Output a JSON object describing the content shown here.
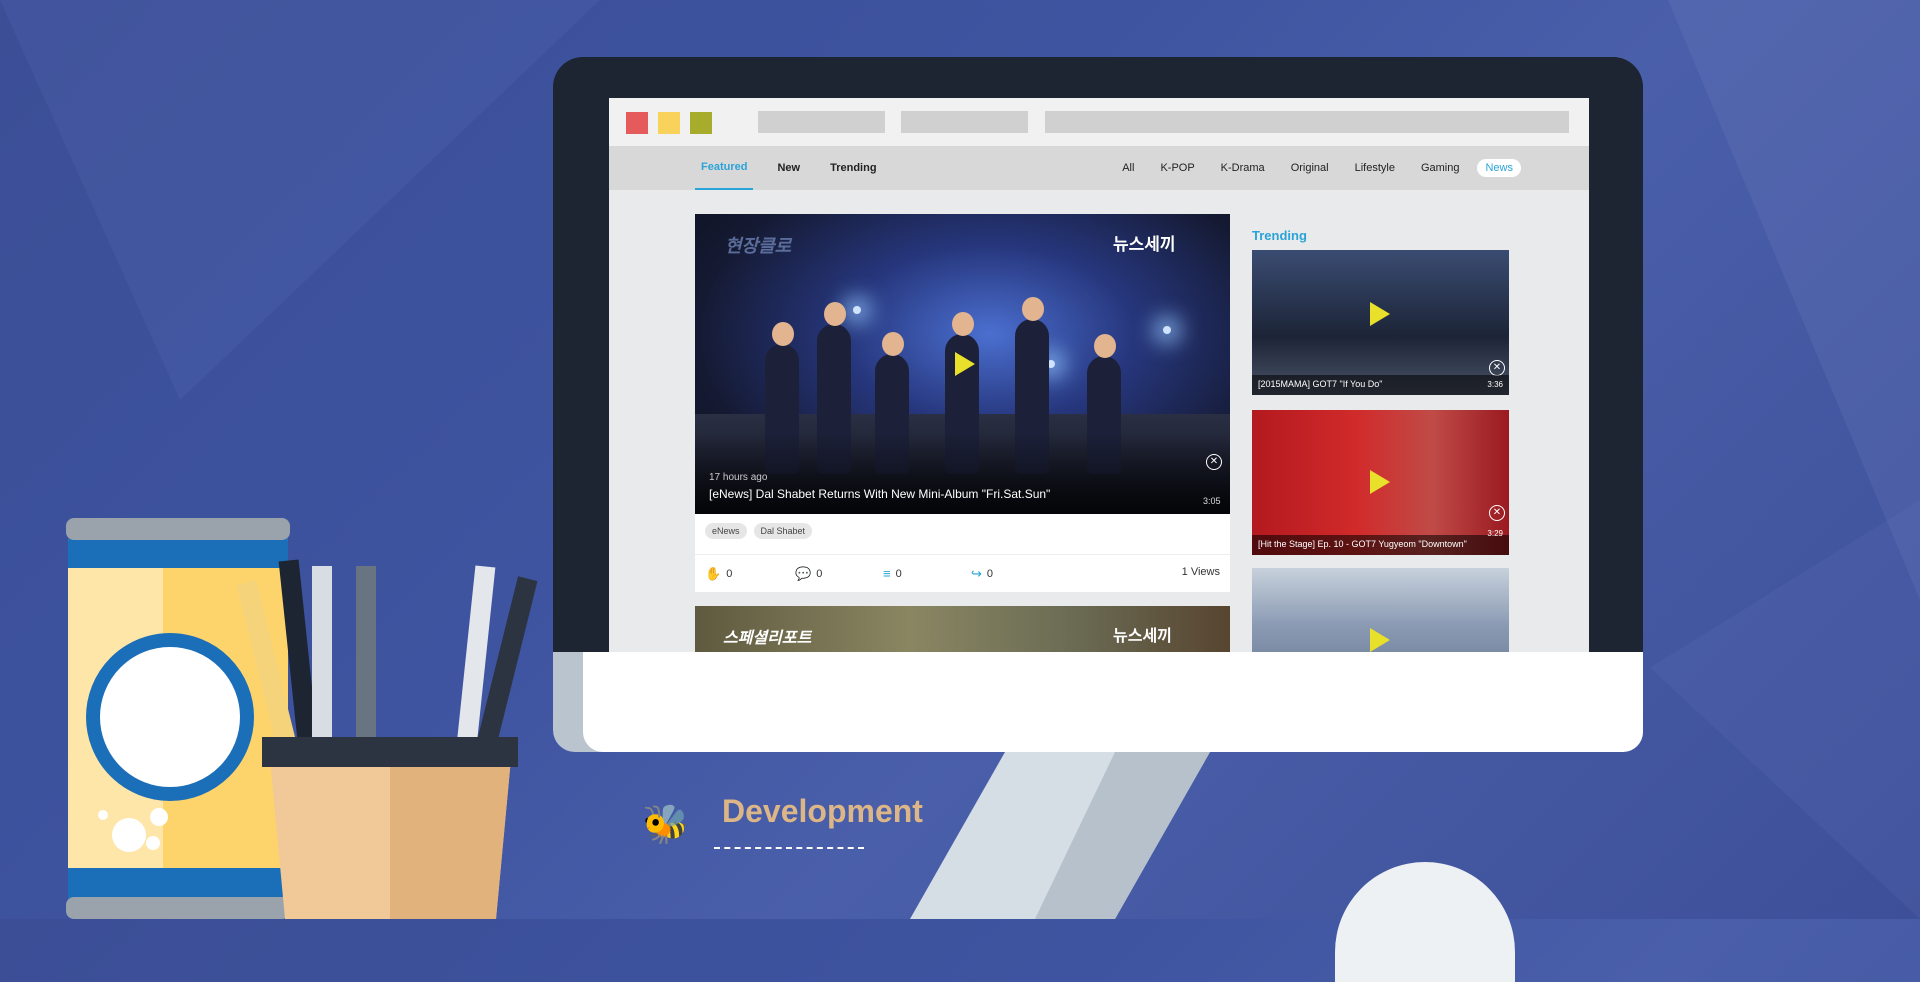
{
  "colors": {
    "accent": "#2aa3d8",
    "background": "#3e54a0",
    "dev_text": "#dcb687"
  },
  "browser": {
    "dots": [
      "#e55b5b",
      "#f8d25a",
      "#a8ac2d"
    ]
  },
  "nav": {
    "left_tabs": [
      {
        "label": "Featured",
        "active": true
      },
      {
        "label": "New",
        "active": false
      },
      {
        "label": "Trending",
        "active": false
      }
    ],
    "right_tabs": [
      {
        "label": "All",
        "active": false
      },
      {
        "label": "K-POP",
        "active": false
      },
      {
        "label": "K-Drama",
        "active": false
      },
      {
        "label": "Original",
        "active": false
      },
      {
        "label": "Lifestyle",
        "active": false
      },
      {
        "label": "Gaming",
        "active": false
      },
      {
        "label": "News",
        "active": true
      }
    ]
  },
  "featured": {
    "brand": "뉴스세끼",
    "brand_left": "현장클로",
    "time_ago": "17 hours ago",
    "title": "[eNews] Dal Shabet Returns With New Mini-Album \"Fri.Sat.Sun\"",
    "duration": "3:05",
    "tags": [
      "eNews",
      "Dal Shabet"
    ],
    "likes": "0",
    "comments": "0",
    "playlist": "0",
    "shares": "0",
    "views": "1 Views"
  },
  "second_card": {
    "brand_left": "스페셜리포트",
    "brand": "뉴스세끼"
  },
  "trending": {
    "heading": "Trending",
    "items": [
      {
        "title": "[2015MAMA] GOT7 \"If You Do\"",
        "duration": "3:36"
      },
      {
        "title": "[Hit the Stage] Ep. 10 - GOT7 Yugyeom \"Downtown\"",
        "duration": "3:29"
      },
      {
        "title": "",
        "duration": ""
      }
    ]
  },
  "footer": {
    "label": "Development"
  }
}
